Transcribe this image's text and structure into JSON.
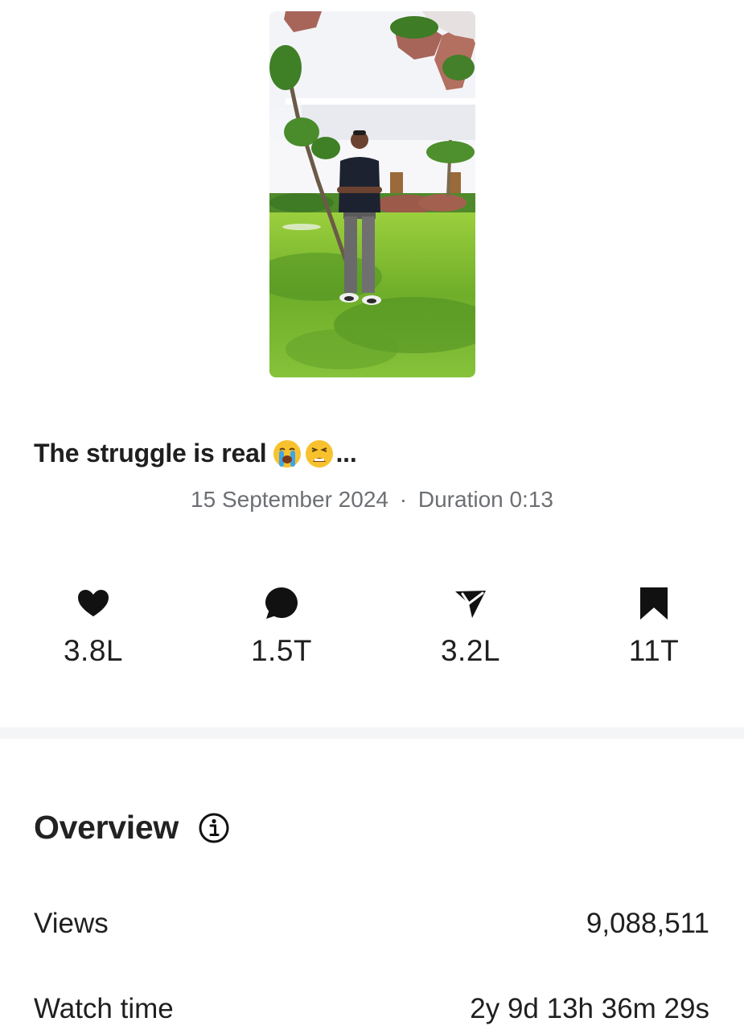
{
  "post": {
    "caption": "The struggle is real",
    "caption_emojis": [
      "loudly-crying-face",
      "weary-face"
    ],
    "caption_ellipsis": "...",
    "date": "15 September 2024",
    "separator": "·",
    "duration": "Duration 0:13"
  },
  "stats": {
    "likes": {
      "icon": "heart-icon",
      "value": "3.8L"
    },
    "comments": {
      "icon": "comment-bubble-icon",
      "value": "1.5T"
    },
    "shares": {
      "icon": "paper-plane-icon",
      "value": "3.2L"
    },
    "saves": {
      "icon": "bookmark-icon",
      "value": "11T"
    }
  },
  "overview": {
    "title": "Overview",
    "info_icon": "info-icon",
    "rows": [
      {
        "label": "Views",
        "value": "9,088,511"
      },
      {
        "label": "Watch time",
        "value": "2y 9d 13h 36m 29s"
      }
    ]
  },
  "colors": {
    "text_primary": "#1f1f1f",
    "text_secondary": "#6c6f73",
    "divider": "#f4f5f6"
  }
}
